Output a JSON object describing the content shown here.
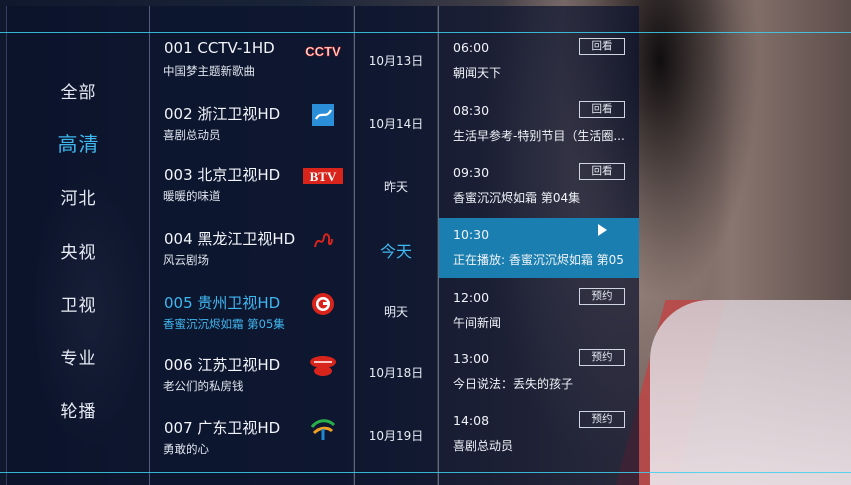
{
  "categories": [
    {
      "label": "全部",
      "active": false
    },
    {
      "label": "高清",
      "active": true
    },
    {
      "label": "河北",
      "active": false
    },
    {
      "label": "央视",
      "active": false
    },
    {
      "label": "卫视",
      "active": false
    },
    {
      "label": "专业",
      "active": false
    },
    {
      "label": "轮播",
      "active": false
    }
  ],
  "channels": [
    {
      "name": "001 CCTV-1HD",
      "program": "中国梦主题新歌曲",
      "logo": "cctv-logo",
      "logo_text": "CCTV"
    },
    {
      "name": "002 浙江卫视HD",
      "program": "喜剧总动员",
      "logo": "zhejiang-tv-logo"
    },
    {
      "name": "003 北京卫视HD",
      "program": "暖暖的味道",
      "logo": "btv-logo",
      "logo_text": "BTV"
    },
    {
      "name": "004 黑龙江卫视HD",
      "program": "风云剧场",
      "logo": "heilongjiang-tv-logo"
    },
    {
      "name": "005 贵州卫视HD",
      "program": "香蜜沉沉烬如霜 第05集",
      "logo": "guizhou-tv-logo",
      "active": true
    },
    {
      "name": "006 江苏卫视HD",
      "program": "老公们的私房钱",
      "logo": "jiangsu-tv-logo"
    },
    {
      "name": "007 广东卫视HD",
      "program": "勇敢的心",
      "logo": "guangdong-tv-logo"
    }
  ],
  "dates": [
    "10月13日",
    "10月14日",
    "昨天",
    "今天",
    "明天",
    "10月18日",
    "10月19日"
  ],
  "programs": [
    {
      "time": "06:00",
      "title": "朝闻天下",
      "button": "回看"
    },
    {
      "time": "08:30",
      "title": "生活早参考-特别节目（生活圈...",
      "button": "回看"
    },
    {
      "time": "09:30",
      "title": "香蜜沉沉烬如霜 第04集",
      "button": "回看"
    },
    {
      "time": "10:30",
      "title": "正在播放: 香蜜沉沉烬如霜 第05",
      "button": "",
      "playing": true
    },
    {
      "time": "12:00",
      "title": "午间新闻",
      "button": "预约"
    },
    {
      "time": "13:00",
      "title": "今日说法：丢失的孩子",
      "button": "预约"
    },
    {
      "time": "14:08",
      "title": "喜剧总动员",
      "button": "预约"
    }
  ],
  "colors": {
    "accent": "#3fb7f0",
    "playing_bg": "#1a7fb0",
    "guide_line": "#3fd0f0",
    "cctv_red": "#d9241b",
    "btv_red": "#d9241b"
  }
}
